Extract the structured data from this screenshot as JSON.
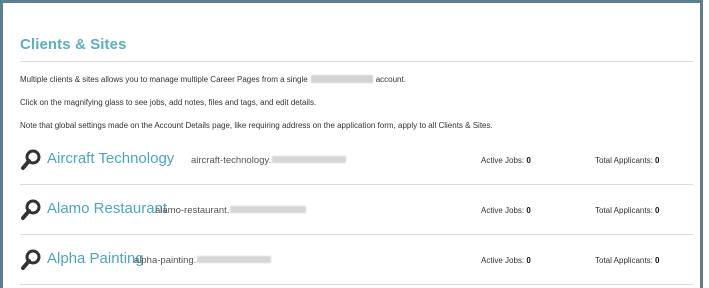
{
  "section": {
    "title": "Clients & Sites",
    "intro_part1": "Multiple clients & sites allows you to manage multiple Career Pages from a single",
    "intro_part2": "account.",
    "line2": "Click on the magnifying glass to see jobs, add notes, files and tags, and edit details.",
    "line3": "Note that global settings made on the Account Details page, like requiring address on the application form, apply to all Clients & Sites."
  },
  "labels": {
    "active_jobs": "Active Jobs:",
    "total_applicants": "Total Applicants:"
  },
  "icons": {
    "search": "magnifying-glass-icon",
    "accent_color": "#4ba6bf"
  },
  "clients": [
    {
      "name": "Aircraft Technology",
      "subdomain": "aircraft-technology.",
      "active_jobs": "0",
      "total_applicants": "0"
    },
    {
      "name": "Alamo Restaurant",
      "subdomain": "alamo-restaurant.",
      "active_jobs": "0",
      "total_applicants": "0"
    },
    {
      "name": "Alpha Painting",
      "subdomain": "alpha-painting.",
      "active_jobs": "0",
      "total_applicants": "0"
    }
  ]
}
